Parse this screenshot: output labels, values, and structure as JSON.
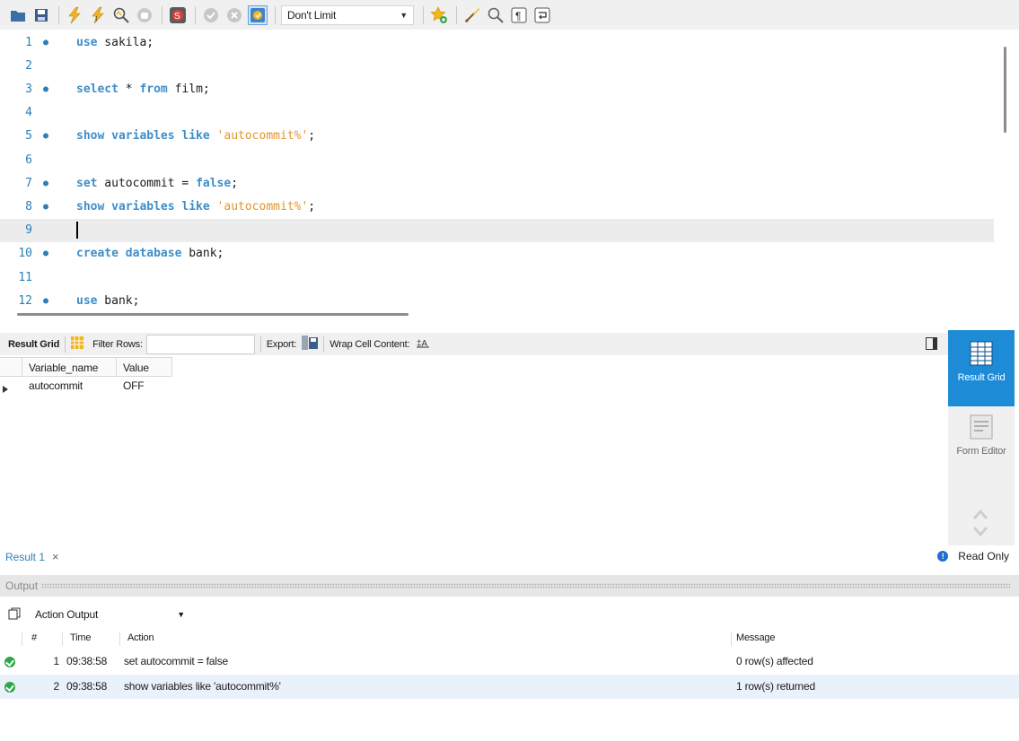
{
  "toolbar": {
    "icons": [
      "open-folder-icon",
      "save-icon",
      "execute-icon",
      "execute-current-icon",
      "explain-icon",
      "stop-icon",
      "toggle-error-icon",
      "commit-icon",
      "rollback-icon",
      "autocommit-icon",
      "beautify-icon",
      "find-icon",
      "invisible-chars-icon",
      "wrap-icon"
    ],
    "limit_value": "Don't Limit"
  },
  "editor": {
    "lines": [
      {
        "num": "1",
        "dot": "●",
        "tokens": [
          {
            "t": "use",
            "c": "kw"
          },
          {
            "t": " sakila;",
            "c": ""
          }
        ]
      },
      {
        "num": "2",
        "dot": "",
        "tokens": []
      },
      {
        "num": "3",
        "dot": "●",
        "tokens": [
          {
            "t": "select",
            "c": "kw"
          },
          {
            "t": " * ",
            "c": ""
          },
          {
            "t": "from",
            "c": "kw"
          },
          {
            "t": " film;",
            "c": ""
          }
        ]
      },
      {
        "num": "4",
        "dot": "",
        "tokens": []
      },
      {
        "num": "5",
        "dot": "●",
        "tokens": [
          {
            "t": "show variables like",
            "c": "kw"
          },
          {
            "t": " ",
            "c": ""
          },
          {
            "t": "'autocommit%'",
            "c": "str"
          },
          {
            "t": ";",
            "c": ""
          }
        ]
      },
      {
        "num": "6",
        "dot": "",
        "tokens": []
      },
      {
        "num": "7",
        "dot": "●",
        "tokens": [
          {
            "t": "set",
            "c": "kw"
          },
          {
            "t": " autocommit = ",
            "c": ""
          },
          {
            "t": "false",
            "c": "kw"
          },
          {
            "t": ";",
            "c": ""
          }
        ]
      },
      {
        "num": "8",
        "dot": "●",
        "tokens": [
          {
            "t": "show variables like",
            "c": "kw"
          },
          {
            "t": " ",
            "c": ""
          },
          {
            "t": "'autocommit%'",
            "c": "str"
          },
          {
            "t": ";",
            "c": ""
          }
        ]
      },
      {
        "num": "9",
        "dot": "",
        "tokens": [],
        "current": true
      },
      {
        "num": "10",
        "dot": "●",
        "tokens": [
          {
            "t": "create database",
            "c": "kw"
          },
          {
            "t": " bank;",
            "c": ""
          }
        ]
      },
      {
        "num": "11",
        "dot": "",
        "tokens": []
      },
      {
        "num": "12",
        "dot": "●",
        "tokens": [
          {
            "t": "use",
            "c": "kw"
          },
          {
            "t": " bank;",
            "c": ""
          }
        ]
      }
    ]
  },
  "result_toolbar": {
    "result_grid_label": "Result Grid",
    "filter_label": "Filter Rows:",
    "filter_value": "",
    "export_label": "Export:",
    "wrap_label": "Wrap Cell Content:"
  },
  "grid": {
    "columns": [
      "Variable_name",
      "Value"
    ],
    "rows": [
      [
        "autocommit",
        "OFF"
      ]
    ]
  },
  "side_panel": {
    "result_grid_label": "Result Grid",
    "form_editor_label": "Form Editor"
  },
  "result_tabs": {
    "tab_label": "Result 1",
    "close_glyph": "×",
    "status": "Read Only"
  },
  "output": {
    "header": "Output",
    "select_value": "Action Output",
    "columns": [
      "#",
      "Time",
      "Action",
      "Message"
    ],
    "rows": [
      {
        "num": "1",
        "time": "09:38:58",
        "action": "set autocommit = false",
        "message": "0 row(s) affected",
        "status": "ok"
      },
      {
        "num": "2",
        "time": "09:38:58",
        "action": "show variables like 'autocommit%'",
        "message": "1 row(s) returned",
        "status": "ok"
      }
    ],
    "row_colors": [
      "#ffffff",
      "#e9f1fb"
    ],
    "status_color": "#2ea84a"
  }
}
